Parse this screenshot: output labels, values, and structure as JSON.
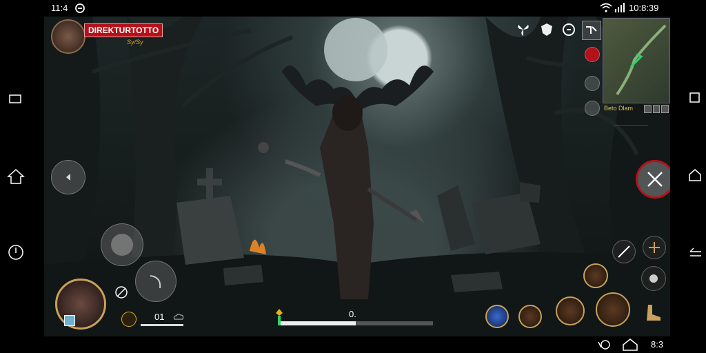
{
  "status": {
    "left_time": "11:4",
    "right_time": "10:8:39"
  },
  "nav": {
    "bottom_time": "8:3"
  },
  "player": {
    "name": "DIREKTURTOTTO",
    "sub": "Sy/Sy"
  },
  "minimap": {
    "label": "Beto Dlam"
  },
  "hud": {
    "ammo": "01",
    "progress_value": "0.",
    "progress_fraction": 0.5
  },
  "colors": {
    "name_bg": "#b3121a",
    "accent": "#c9a15a",
    "minimap_path": "#2fd36a"
  }
}
